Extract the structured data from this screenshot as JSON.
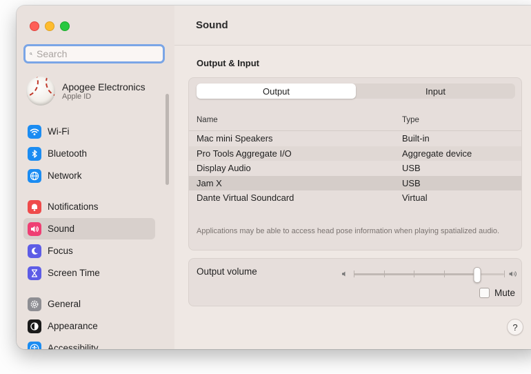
{
  "search": {
    "placeholder": "Search",
    "value": ""
  },
  "account": {
    "name": "Apogee Electronics",
    "subtitle": "Apple ID"
  },
  "sidebar": {
    "items": [
      {
        "label": "Wi-Fi",
        "icon": "wifi-icon",
        "color": "#1b8cf2"
      },
      {
        "label": "Bluetooth",
        "icon": "bluetooth-icon",
        "color": "#1b8cf2"
      },
      {
        "label": "Network",
        "icon": "globe-icon",
        "color": "#1b8cf2"
      },
      {
        "label": "Notifications",
        "icon": "bell-icon",
        "color": "#ef4b4b"
      },
      {
        "label": "Sound",
        "icon": "speaker-icon",
        "color": "#ef3f73"
      },
      {
        "label": "Focus",
        "icon": "moon-icon",
        "color": "#5d5ce6"
      },
      {
        "label": "Screen Time",
        "icon": "hourglass-icon",
        "color": "#5d5ce6"
      },
      {
        "label": "General",
        "icon": "gear-icon",
        "color": "#8e8e93"
      },
      {
        "label": "Appearance",
        "icon": "appearance-icon",
        "color": "#1a1a1a"
      },
      {
        "label": "Accessibility",
        "icon": "accessibility-icon",
        "color": "#1b8cf2"
      }
    ],
    "selected": "Sound"
  },
  "main": {
    "title": "Sound",
    "section_title": "Output & Input",
    "tabs": [
      {
        "label": "Output",
        "active": true
      },
      {
        "label": "Input",
        "active": false
      }
    ],
    "table": {
      "headers": [
        "Name",
        "Type"
      ],
      "rows": [
        {
          "name": "Mac mini Speakers",
          "type": "Built-in"
        },
        {
          "name": "Pro Tools Aggregate I/O",
          "type": "Aggregate device"
        },
        {
          "name": "Display Audio",
          "type": "USB"
        },
        {
          "name": "Jam X",
          "type": "USB",
          "selected": true
        },
        {
          "name": "Dante Virtual Soundcard",
          "type": "Virtual"
        }
      ]
    },
    "note": "Applications may be able to access head pose information when playing spatialized audio.",
    "volume": {
      "label": "Output volume",
      "level": 0.82
    },
    "mute": {
      "label": "Mute",
      "checked": false
    },
    "help_label": "?"
  }
}
